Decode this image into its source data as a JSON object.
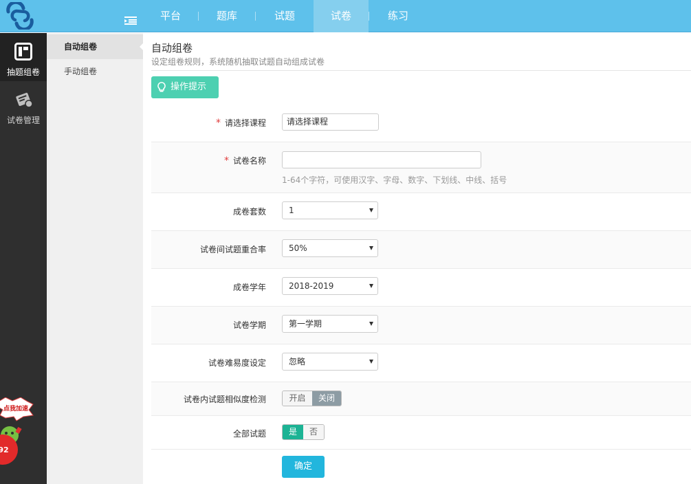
{
  "topbar": {
    "nav": [
      {
        "label": "平台",
        "active": false
      },
      {
        "label": "题库",
        "active": false
      },
      {
        "label": "试题",
        "active": false
      },
      {
        "label": "试卷",
        "active": true
      },
      {
        "label": "练习",
        "active": false
      }
    ]
  },
  "sidebar": {
    "items": [
      {
        "label": "抽题组卷",
        "icon": "layout-icon",
        "active": true
      },
      {
        "label": "试卷管理",
        "icon": "paper-stack-icon",
        "active": false
      }
    ],
    "promo": {
      "label": "点我加速",
      "number": "92"
    }
  },
  "subnav": {
    "items": [
      {
        "label": "自动组卷",
        "active": true
      },
      {
        "label": "手动组卷",
        "active": false
      }
    ]
  },
  "page": {
    "title": "自动组卷",
    "description": "设定组卷规则，系统随机抽取试题自动组成试卷",
    "tip_button": "操作提示"
  },
  "form": {
    "course": {
      "label": "请选择课程",
      "required": true,
      "value": "请选择课程"
    },
    "paper_name": {
      "label": "试卷名称",
      "required": true,
      "value": "",
      "hint": "1-64个字符，可使用汉字、字母、数字、下划线、中线、括号"
    },
    "paper_count": {
      "label": "成卷套数",
      "value": "1"
    },
    "overlap_rate": {
      "label": "试卷间试题重合率",
      "value": "50%"
    },
    "school_year": {
      "label": "成卷学年",
      "value": "2018-2019"
    },
    "semester": {
      "label": "试卷学期",
      "value": "第一学期"
    },
    "difficulty": {
      "label": "试卷难易度设定",
      "value": "忽略"
    },
    "similarity_check": {
      "label": "试卷内试题相似度检测",
      "on_label": "开启",
      "off_label": "关闭",
      "selected": "关闭"
    },
    "all_questions": {
      "label": "全部试题",
      "yes_label": "是",
      "no_label": "否",
      "selected": "是"
    }
  },
  "confirm_button": "确定",
  "colors": {
    "topbar": "#5ec1eb",
    "sidebar": "#2f2f2f",
    "tip_button": "#4dd0b1",
    "confirm_button": "#22b6dd",
    "required": "#e03c3c"
  }
}
